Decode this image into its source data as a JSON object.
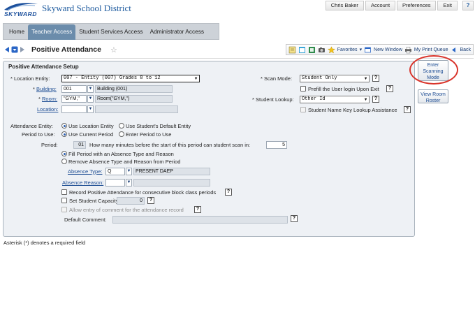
{
  "header": {
    "logo_text": "SKYWARD",
    "district": "Skyward School District",
    "user": "Chris Baker",
    "nav": [
      "Account",
      "Preferences",
      "Exit"
    ],
    "help": "?"
  },
  "tabs": [
    {
      "label": "Home",
      "active": false
    },
    {
      "label": "Teacher Access",
      "active": true
    },
    {
      "label": "Student Services Access",
      "active": false
    },
    {
      "label": "Administrator Access",
      "active": false
    }
  ],
  "page": {
    "title": "Positive Attendance"
  },
  "toolbar": {
    "favorites": "Favorites",
    "new_window": "New Window",
    "print_queue": "My Print Queue",
    "back": "Back"
  },
  "setup": {
    "section_title": "Positive Attendance Setup",
    "location_entity_label": "* Location Entity:",
    "location_entity_value": "007 - Entity (007) Grades 8 to 12",
    "building_label": "Building:",
    "building_code": "001",
    "building_name": "Building (001)",
    "room_label": "Room:",
    "room_code": "\"GYM,\"",
    "room_name": "Room(\"GYM,\")",
    "location_label": "Location:",
    "location_code": "",
    "location_name": "",
    "scan_mode_label": "* Scan Mode:",
    "scan_mode_value": "Student Only",
    "prefill_label": "Prefill the User login Upon Exit",
    "student_lookup_label": "* Student Lookup:",
    "student_lookup_value": "Other Id",
    "name_lookup_label": "Student Name Key Lookup Assistance",
    "attendance_entity_label": "Attendance Entity:",
    "attendance_entity_opt1": "Use Location Entity",
    "attendance_entity_opt2": "Use Student's Default Entity",
    "period_to_use_label": "Period to Use:",
    "period_to_use_opt1": "Use Current Period",
    "period_to_use_opt2": "Enter Period to Use",
    "period_label": "Period:",
    "period_value": "01",
    "minutes_label": "How many minutes before the start of this period can student scan in:",
    "minutes_value": "5",
    "fill_opt": "Fill Period with an Absence Type and Reason",
    "remove_opt": "Remove Absence Type and Reason from Period",
    "absence_type_label": "Absence Type:",
    "absence_type_code": "Q",
    "absence_type_name": "PRESENT DAEP",
    "absence_reason_label": "Absence Reason:",
    "absence_reason_code": "",
    "absence_reason_name": "",
    "record_consecutive": "Record Positive Attendance for consecutive block class periods",
    "set_capacity": "Set Student Capacity",
    "capacity_value": "0",
    "allow_comment": "Allow entry of comment for the attendance record",
    "default_comment_label": "Default Comment:",
    "default_comment_value": ""
  },
  "side": {
    "enter_scanning": "Enter Scanning Mode",
    "view_roster": "View Room Roster"
  },
  "footnote": "Asterisk (*) denotes a required field",
  "colors": {
    "accent": "#1c4c93",
    "active_tab": "#6b8cab",
    "highlight_circle": "#d9342b"
  }
}
